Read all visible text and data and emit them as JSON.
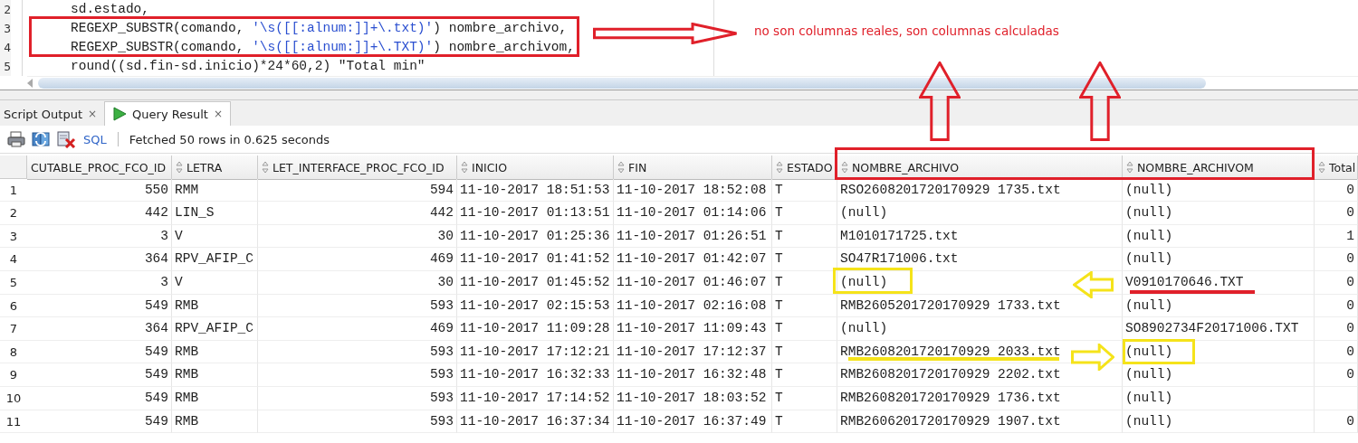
{
  "editor": {
    "lines": [
      {
        "number": "2",
        "segments": [
          {
            "kind": "plain",
            "text": "sd.estado,"
          }
        ]
      },
      {
        "number": "3",
        "segments": [
          {
            "kind": "plain",
            "text": "REGEXP_SUBSTR(comando, "
          },
          {
            "kind": "string",
            "text": "'\\s([[:alnum:]]+\\.txt)'"
          },
          {
            "kind": "plain",
            "text": ") nombre_archivo,"
          }
        ]
      },
      {
        "number": "4",
        "segments": [
          {
            "kind": "plain",
            "text": "REGEXP_SUBSTR(comando, "
          },
          {
            "kind": "string",
            "text": "'\\s([[:alnum:]]+\\.TXT)'"
          },
          {
            "kind": "plain",
            "text": ") nombre_archivom,"
          }
        ]
      },
      {
        "number": "5",
        "segments": [
          {
            "kind": "plain",
            "text": "round((sd.fin-sd.inicio)*24*60,2) \"Total min\""
          }
        ]
      }
    ]
  },
  "tabs": [
    {
      "label": "Script Output",
      "selected": false,
      "close": "×"
    },
    {
      "label": "Query Result",
      "selected": true,
      "close": "×"
    }
  ],
  "toolbar": {
    "link": "SQL",
    "status": "Fetched 50 rows in 0.625 seconds"
  },
  "table": {
    "columns": [
      "CUTABLE_PROC_FCO_ID",
      "LETRA",
      "LET_INTERFACE_PROC_FCO_ID",
      "INICIO",
      "FIN",
      "ESTADO",
      "NOMBRE_ARCHIVO",
      "NOMBRE_ARCHIVOM",
      "Total"
    ],
    "rows": [
      {
        "number": "1",
        "cells": [
          "550",
          "RMM",
          "594",
          "11-10-2017 18:51:53",
          "11-10-2017 18:52:08",
          "T",
          "RSO2608201720170929 1735.txt",
          "(null)",
          "0"
        ]
      },
      {
        "number": "2",
        "cells": [
          "442",
          "LIN_S",
          "442",
          "11-10-2017 01:13:51",
          "11-10-2017 01:14:06",
          "T",
          "(null)",
          "(null)",
          "0"
        ]
      },
      {
        "number": "3",
        "cells": [
          "3",
          "V",
          "30",
          "11-10-2017 01:25:36",
          "11-10-2017 01:26:51",
          "T",
          "M1010171725.txt",
          "(null)",
          "1"
        ]
      },
      {
        "number": "4",
        "cells": [
          "364",
          "RPV_AFIP_C",
          "469",
          "11-10-2017 01:41:52",
          "11-10-2017 01:42:07",
          "T",
          "SO47R171006.txt",
          "(null)",
          "0"
        ]
      },
      {
        "number": "5",
        "cells": [
          "3",
          "V",
          "30",
          "11-10-2017 01:45:52",
          "11-10-2017 01:46:07",
          "T",
          "(null)",
          "V0910170646.TXT",
          "0"
        ]
      },
      {
        "number": "6",
        "cells": [
          "549",
          "RMB",
          "593",
          "11-10-2017 02:15:53",
          "11-10-2017 02:16:08",
          "T",
          "RMB2605201720170929 1733.txt",
          "(null)",
          "0"
        ]
      },
      {
        "number": "7",
        "cells": [
          "364",
          "RPV_AFIP_C",
          "469",
          "11-10-2017 11:09:28",
          "11-10-2017 11:09:43",
          "T",
          "(null)",
          "SO8902734F20171006.TXT",
          "0"
        ]
      },
      {
        "number": "8",
        "cells": [
          "549",
          "RMB",
          "593",
          "11-10-2017 17:12:21",
          "11-10-2017 17:12:37",
          "T",
          "RMB2608201720170929 2033.txt",
          "(null)",
          "0"
        ]
      },
      {
        "number": "9",
        "cells": [
          "549",
          "RMB",
          "593",
          "11-10-2017 16:32:33",
          "11-10-2017 16:32:48",
          "T",
          "RMB2608201720170929 2202.txt",
          "(null)",
          "0"
        ]
      },
      {
        "number": "10",
        "cells": [
          "549",
          "RMB",
          "593",
          "11-10-2017 17:14:52",
          "11-10-2017 18:03:52",
          "T",
          "RMB2608201720170929 1736.txt",
          "(null)",
          ""
        ]
      },
      {
        "number": "11",
        "cells": [
          "549",
          "RMB",
          "593",
          "11-10-2017 16:37:34",
          "11-10-2017 16:37:49",
          "T",
          "RMB2606201720170929 1907.txt",
          "(null)",
          "0"
        ]
      }
    ]
  },
  "annotations": [
    {
      "kind": "box",
      "color": "#e0202a"
    },
    {
      "kind": "arrow_right",
      "color": "#e0202a"
    },
    {
      "kind": "note",
      "color": "#e0202a",
      "text": "no son columnas reales, son columnas calculadas"
    },
    {
      "kind": "arrow_up",
      "color": "#e0202a"
    },
    {
      "kind": "arrow_up",
      "color": "#e0202a"
    },
    {
      "kind": "box",
      "color": "#e0202a"
    },
    {
      "kind": "box",
      "color": "#f5e31a"
    },
    {
      "kind": "arrow_left",
      "color": "#f5e31a"
    },
    {
      "kind": "underline",
      "color": "#e0202a"
    },
    {
      "kind": "underline",
      "color": "#f5e31a"
    },
    {
      "kind": "arrow_right",
      "color": "#f5e31a"
    },
    {
      "kind": "box",
      "color": "#f5e31a"
    }
  ]
}
